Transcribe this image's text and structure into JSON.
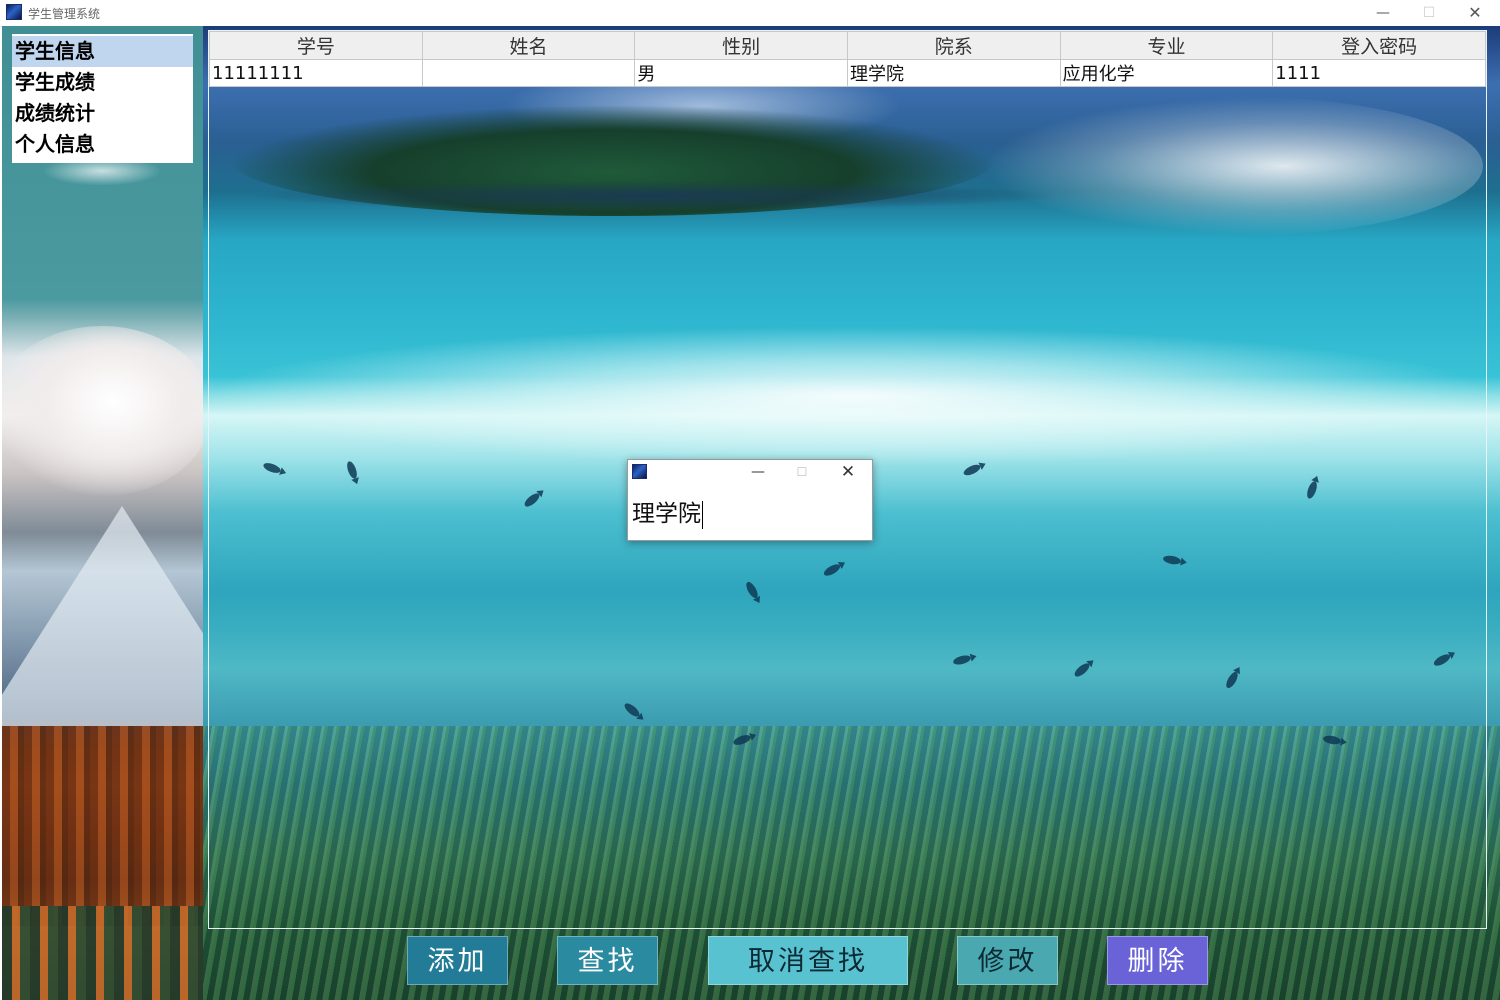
{
  "window": {
    "title": "学生管理系统",
    "minimize_glyph": "—",
    "maximize_glyph": "☐",
    "close_glyph": "✕"
  },
  "sidebar": {
    "items": [
      {
        "label": "学生信息",
        "selected": true
      },
      {
        "label": "学生成绩",
        "selected": false
      },
      {
        "label": "成绩统计",
        "selected": false
      },
      {
        "label": "个人信息",
        "selected": false
      }
    ]
  },
  "table": {
    "columns": [
      "学号",
      "姓名",
      "性别",
      "院系",
      "专业",
      "登入密码"
    ],
    "rows": [
      [
        "11111111",
        "",
        "男",
        "理学院",
        "应用化学",
        "1111"
      ]
    ]
  },
  "buttons": {
    "add": "添加",
    "find": "查找",
    "cancel_find": "取消查找",
    "edit": "修改",
    "delete": "删除"
  },
  "popup": {
    "minimize_glyph": "—",
    "maximize_glyph": "☐",
    "close_glyph": "✕",
    "input_value": "理学院"
  },
  "colors": {
    "selected_item": "#bfd6ee",
    "button_add": "#237c97",
    "button_find": "#2a8aa0",
    "button_cancel_find": "#58c2d0",
    "button_edit": "#4aa8b0",
    "button_delete": "#6a63d8"
  }
}
